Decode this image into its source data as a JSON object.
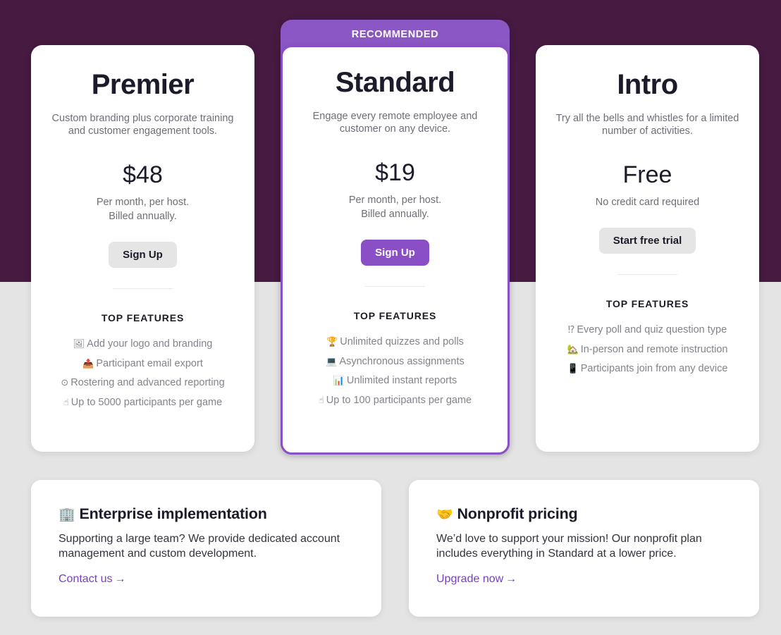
{
  "theme": {
    "band_purple": "#471a41",
    "page_bg": "#e4e4e4",
    "accent_purple": "#8a4fc4",
    "banner_purple": "#8a57c4",
    "link_purple": "#7a3fc0",
    "text_dark": "#1b1b2a",
    "text_muted": "#6e6e78",
    "feature_gray": "#83838c"
  },
  "plans": [
    {
      "id": "premier",
      "name": "Premier",
      "tagline": "Custom branding plus corporate training and customer engagement tools.",
      "price": "$48",
      "price_note": "Per month, per host.\nBilled annually.",
      "cta_label": "Sign Up",
      "cta_style": "gray",
      "features_heading": "TOP FEATURES",
      "features": [
        {
          "icon": "framed-picture-icon",
          "glyph": "🖼",
          "label": "Add your logo and branding"
        },
        {
          "icon": "outbox-tray-icon",
          "glyph": "📤",
          "label": "Participant email export"
        },
        {
          "icon": "record-icon",
          "glyph": "⊙",
          "label": "Rostering and advanced reporting"
        },
        {
          "icon": "index-pointing-up-icon",
          "glyph": "☝",
          "label": "Up to 5000 participants per game"
        }
      ]
    },
    {
      "id": "standard",
      "name": "Standard",
      "badge": "RECOMMENDED",
      "tagline": "Engage every remote employee and customer on any device.",
      "price": "$19",
      "price_note": "Per month, per host.\nBilled annually.",
      "cta_label": "Sign Up",
      "cta_style": "purple",
      "features_heading": "TOP FEATURES",
      "features": [
        {
          "icon": "trophy-icon",
          "glyph": "🏆",
          "label": "Unlimited quizzes and polls"
        },
        {
          "icon": "laptop-icon",
          "glyph": "💻",
          "label": "Asynchronous assignments"
        },
        {
          "icon": "bar-chart-icon",
          "glyph": "📊",
          "label": "Unlimited instant reports"
        },
        {
          "icon": "index-pointing-up-icon",
          "glyph": "☝",
          "label": "Up to 100 participants per game"
        }
      ]
    },
    {
      "id": "intro",
      "name": "Intro",
      "tagline": "Try all the bells and whistles for a limited number of activities.",
      "price": "Free",
      "price_note": "No credit card required",
      "cta_label": "Start free trial",
      "cta_style": "gray",
      "features_heading": "TOP FEATURES",
      "features": [
        {
          "icon": "exclamation-question-icon",
          "glyph": "⁉",
          "label": "Every poll and quiz question type"
        },
        {
          "icon": "house-with-garden-icon",
          "glyph": "🏡",
          "label": "In-person and remote instruction"
        },
        {
          "icon": "mobile-phone-icon",
          "glyph": "📱",
          "label": "Participants join from any device"
        }
      ]
    }
  ],
  "info_cards": [
    {
      "id": "enterprise",
      "icon": "office-building-icon",
      "glyph": "🏢",
      "title": "Enterprise implementation",
      "body": "Supporting a large team? We provide dedicated account management and custom development.",
      "link_label": "Contact us",
      "link_arrow": "→"
    },
    {
      "id": "nonprofit",
      "icon": "handshake-icon",
      "glyph": "🤝",
      "title": "Nonprofit pricing",
      "body": "We’d love to support your mission! Our nonprofit plan includes everything in Standard at a lower price.",
      "link_label": "Upgrade now",
      "link_arrow": "→"
    }
  ]
}
